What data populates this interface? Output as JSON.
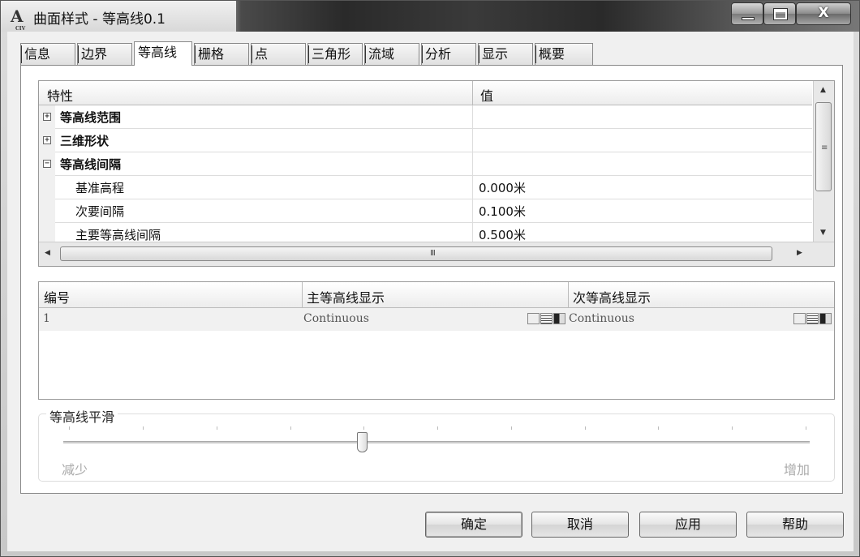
{
  "window": {
    "title": "曲面样式 - 等高线0.1",
    "minimize_glyph": "",
    "close_glyph": "X"
  },
  "tabs": [
    {
      "label": "信息"
    },
    {
      "label": "边界"
    },
    {
      "label": "等高线"
    },
    {
      "label": "栅格"
    },
    {
      "label": "点"
    },
    {
      "label": "三角形"
    },
    {
      "label": "流域"
    },
    {
      "label": "分析"
    },
    {
      "label": "显示"
    },
    {
      "label": "概要"
    }
  ],
  "active_tab": "等高线",
  "property_grid": {
    "header_property": "特性",
    "header_value": "值",
    "rows": [
      {
        "expander": "+",
        "name": "等高线范围",
        "value": ""
      },
      {
        "expander": "+",
        "name": "三维形状",
        "value": ""
      },
      {
        "expander": "−",
        "name": "等高线间隔",
        "value": ""
      },
      {
        "expander": "",
        "name": "基准高程",
        "value": "0.000米"
      },
      {
        "expander": "",
        "name": "次要间隔",
        "value": "0.100米"
      },
      {
        "expander": "",
        "name": "主要等高线间隔",
        "value": "0.500米"
      }
    ],
    "hscroll_grip": "III",
    "vscroll_grip": "≡"
  },
  "contour_list": {
    "col_number": "编号",
    "col_major": "主等高线显示",
    "col_minor": "次等高线显示",
    "rows": [
      {
        "number": "1",
        "major": "Continuous",
        "minor": "Continuous"
      }
    ]
  },
  "smoothing": {
    "legend": "等高线平滑",
    "min_label": "减少",
    "max_label": "增加",
    "level_fraction": 0.4
  },
  "buttons": {
    "ok": "确定",
    "cancel": "取消",
    "apply": "应用",
    "help": "帮助"
  }
}
